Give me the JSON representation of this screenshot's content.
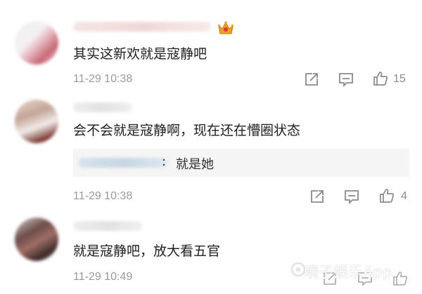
{
  "comments": [
    {
      "text": "其实这新欢就是寇静吧",
      "time": "11-29 10:38",
      "likes": "15"
    },
    {
      "text": "会不会就是寇静啊，现在还在懵圈状态",
      "reply": {
        "sep": ":",
        "text": "就是她"
      },
      "time": "11-29 10:38",
      "likes": "4"
    },
    {
      "text": "就是寇静吧，放大看五官",
      "time": "11-29 10:49"
    }
  ],
  "watermark": "嘀子娱乐App",
  "icons": {
    "repost": "share-square-icon",
    "comment": "comment-bubble-icon",
    "like": "thumbs-up-icon",
    "badge": "crown-badge-icon"
  },
  "colors": {
    "badge": "#f0a020",
    "badge_gem": "#e0342f"
  }
}
